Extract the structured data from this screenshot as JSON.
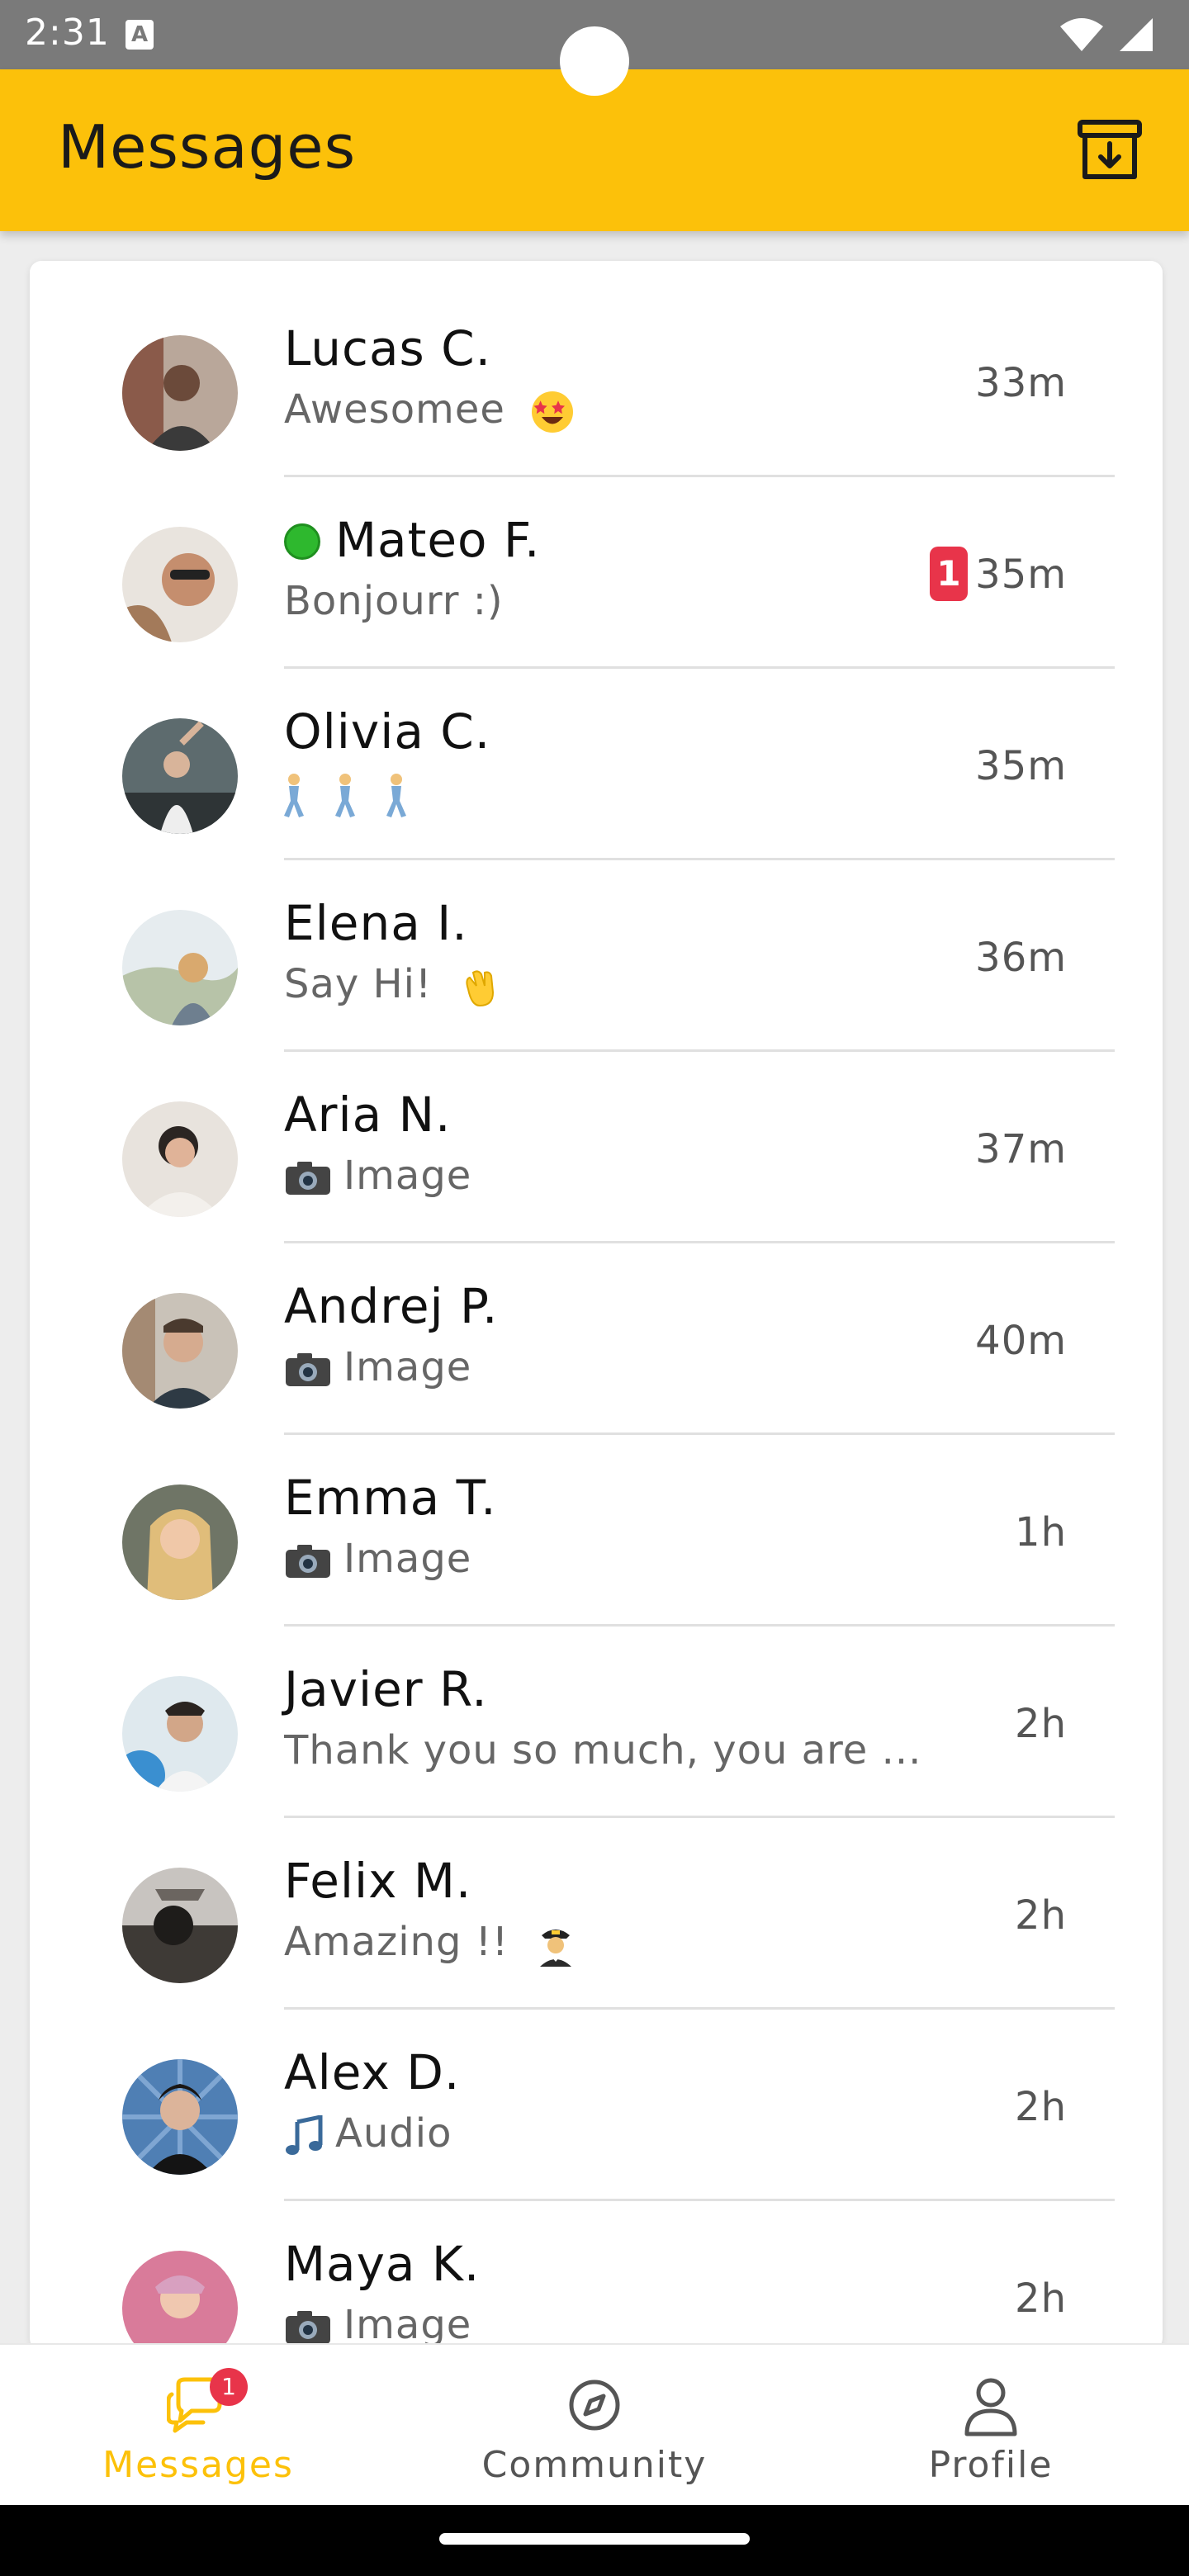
{
  "status_bar": {
    "time": "2:31",
    "notification_letter": "A"
  },
  "app_bar": {
    "title": "Messages",
    "action_icon": "archive-download-icon",
    "accent_color": "#fcc10a"
  },
  "conversations": [
    {
      "name": "Lucas C.",
      "preview": "Awesomee",
      "emoji": "star-struck-emoji",
      "time": "33m"
    },
    {
      "name": "Mateo F.",
      "preview": "Bonjourr :)",
      "time": "35m",
      "unread": "1",
      "status": "green-circle"
    },
    {
      "name": "Olivia C.",
      "preview": "",
      "emoji": "dancing-man-emoji-x3",
      "time": "35m"
    },
    {
      "name": "Elena I.",
      "preview": "Say Hi!",
      "emoji": "waving-hand-emoji",
      "time": "36m"
    },
    {
      "name": "Aria N.",
      "preview": "Image",
      "prefix_icon": "camera-icon",
      "time": "37m"
    },
    {
      "name": "Andrej P.",
      "preview": "Image",
      "prefix_icon": "camera-icon",
      "time": "40m"
    },
    {
      "name": "Emma T.",
      "preview": "Image",
      "prefix_icon": "camera-icon",
      "time": "1h"
    },
    {
      "name": "Javier R.",
      "preview": "Thank you so much, you are ...",
      "time": "2h"
    },
    {
      "name": "Felix M.",
      "preview": "Amazing !!",
      "emoji": "pilot-emoji",
      "time": "2h"
    },
    {
      "name": "Alex D.",
      "preview": "Audio",
      "prefix_icon": "music-note-icon",
      "time": "2h"
    },
    {
      "name": "Maya K.",
      "preview": "Image",
      "prefix_icon": "camera-icon",
      "time": "2h"
    }
  ],
  "bottom_nav": {
    "items": [
      {
        "label": "Messages",
        "icon": "chat-bubbles-icon",
        "badge": "1",
        "active": true
      },
      {
        "label": "Community",
        "icon": "compass-icon",
        "active": false
      },
      {
        "label": "Profile",
        "icon": "person-icon",
        "active": false
      }
    ]
  }
}
